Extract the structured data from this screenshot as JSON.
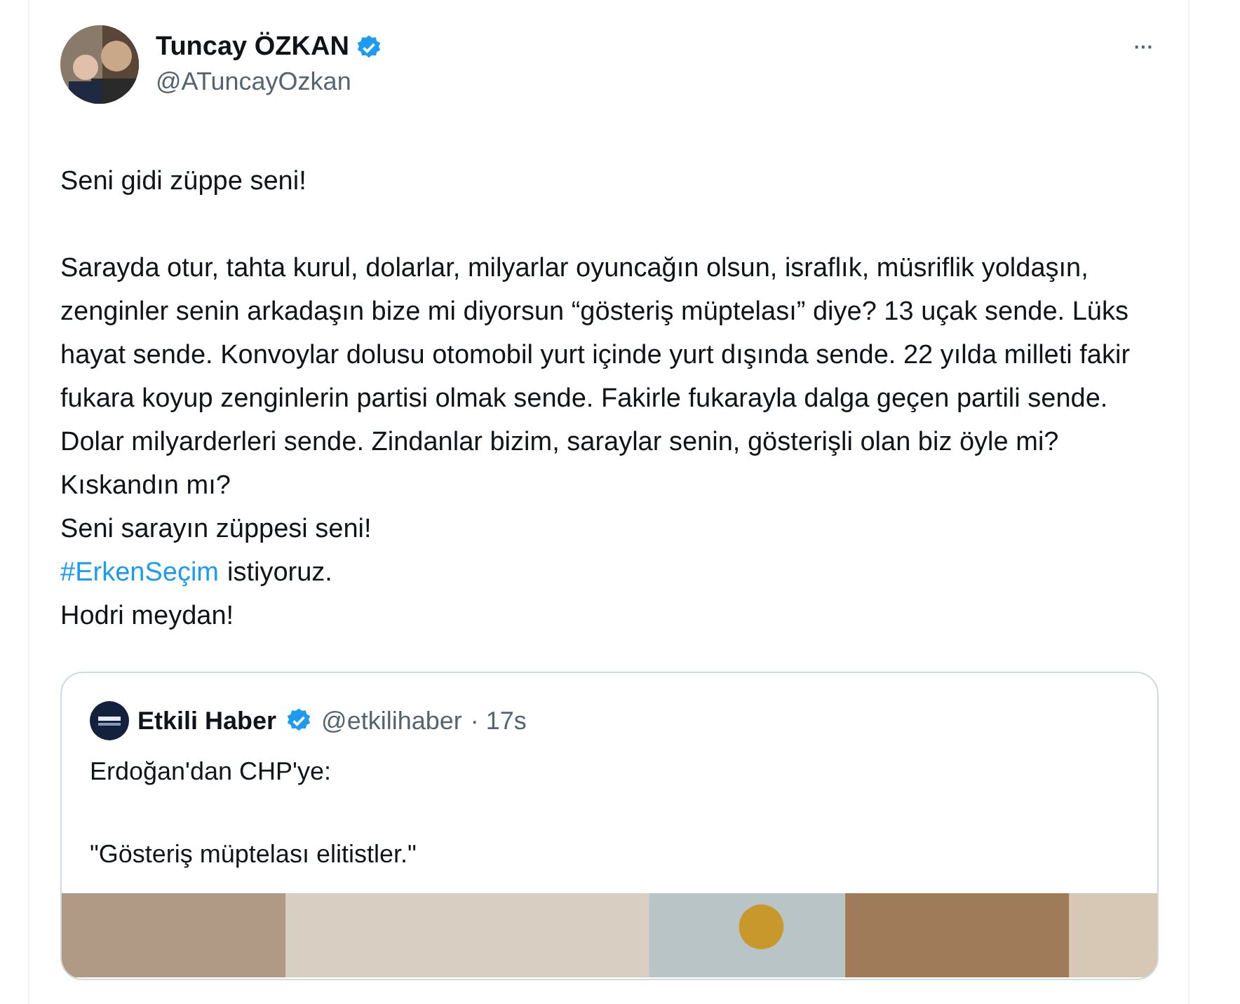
{
  "author": {
    "name": "Tuncay ÖZKAN",
    "handle": "@ATuncayOzkan",
    "verified": true
  },
  "more_menu": "···",
  "body": [
    {
      "kind": "text",
      "text": "Seni gidi züppe seni!"
    },
    {
      "kind": "gap"
    },
    {
      "kind": "text",
      "text": "Sarayda otur, tahta kurul, dolarlar, milyarlar oyuncağın olsun, israflık, müsriflik yoldaşın, zenginler senin arkadaşın bize mi diyorsun “gösteriş müptelası” diye? 13 uçak sende. Lüks hayat sende. Konvoylar dolusu otomobil yurt içinde yurt dışında sende. 22 yılda milleti fakir fukara koyup zenginlerin partisi olmak sende. Fakirle fukarayla dalga geçen partili sende. Dolar milyarderleri sende. Zindanlar bizim, saraylar senin, gösterişli olan biz öyle mi?"
    },
    {
      "kind": "text",
      "text": "Kıskandın mı?"
    },
    {
      "kind": "text",
      "text": "Seni sarayın züppesi seni!"
    },
    {
      "kind": "hashtag",
      "tag": "#ErkenSeçim",
      "text": "istiyoruz."
    },
    {
      "kind": "text",
      "text": "Hodri meydan!"
    }
  ],
  "quote": {
    "name": "Etkili Haber",
    "verified": true,
    "handle": "@etkilihaber",
    "time": "· 17s",
    "body": [
      {
        "kind": "text",
        "text": "Erdoğan'dan CHP'ye:"
      },
      {
        "kind": "gap"
      },
      {
        "kind": "text",
        "text": "\"Gösteriş müptelası elitistler.\""
      }
    ]
  }
}
